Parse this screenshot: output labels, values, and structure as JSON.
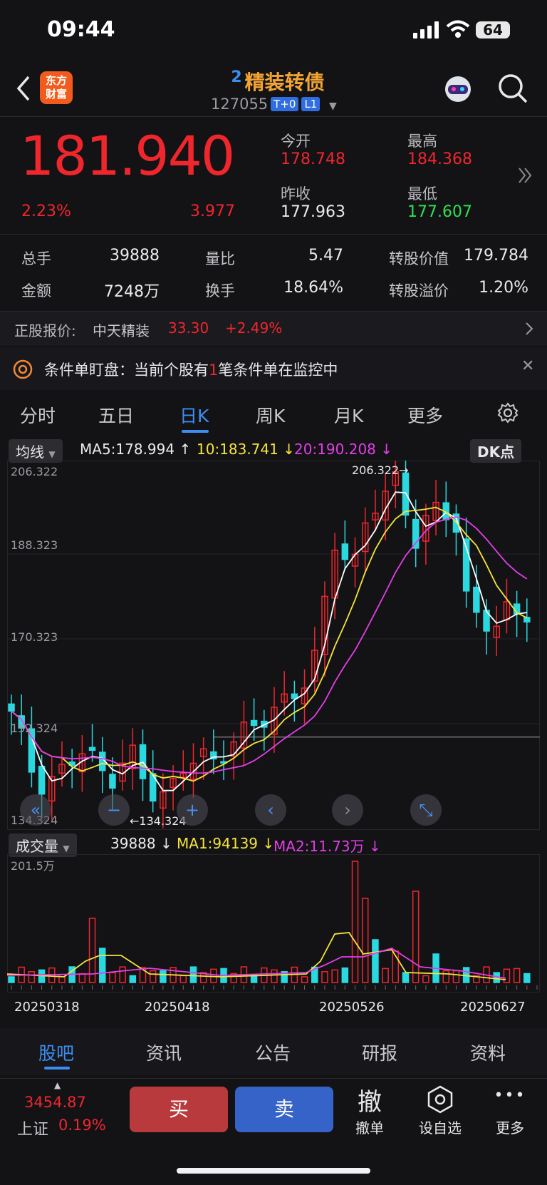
{
  "status_bar": {
    "time": "09:44",
    "battery": "64"
  },
  "header": {
    "logo_text": "东方\n财富",
    "badge": "2",
    "title": "精装转债",
    "code": "127055",
    "tags": [
      "T+0",
      "L1"
    ]
  },
  "quote": {
    "price": "181.940",
    "change_pct": "2.23%",
    "change": "3.977",
    "open_label": "今开",
    "open": "178.748",
    "high_label": "最高",
    "high": "184.368",
    "prev_close_label": "昨收",
    "prev_close": "177.963",
    "low_label": "最低",
    "low": "177.607"
  },
  "stats": [
    {
      "label": "总手",
      "value": "39888"
    },
    {
      "label": "量比",
      "value": "5.47"
    },
    {
      "label": "转股价值",
      "value": "179.784"
    },
    {
      "label": "金额",
      "value": "7248万"
    },
    {
      "label": "换手",
      "value": "18.64%"
    },
    {
      "label": "转股溢价",
      "value": "1.20%"
    }
  ],
  "stock_quote": {
    "label": "正股报价:",
    "name": "中天精装",
    "price": "33.30",
    "change": "+2.49%"
  },
  "notice": {
    "prefix": "条件单盯盘：当前个股有",
    "count": "1",
    "suffix": "笔条件单在监控中"
  },
  "kline_tabs": [
    "分时",
    "五日",
    "日K",
    "周K",
    "月K",
    "更多"
  ],
  "active_kline_tab": "日K",
  "ma_legend": {
    "selector": "均线",
    "ma5": "MA5:178.994",
    "ma10": "10:183.741",
    "ma20": "20:190.208",
    "dk": "DK点"
  },
  "price_axis": [
    "206.322",
    "188.323",
    "170.323",
    "152.324",
    "134.324"
  ],
  "annotations": {
    "high": "206.322",
    "low": "134.324"
  },
  "vol_legend": {
    "selector": "成交量",
    "vol": "39888",
    "ma1": "MA1:94139",
    "ma2": "MA2:11.73万"
  },
  "vol_axis": "201.5万",
  "dates": [
    "20250318",
    "20250418",
    "20250526",
    "20250627"
  ],
  "colors": {
    "up": "#f0262d",
    "down": "#2ad8e0",
    "ma5": "#ffffff",
    "ma10": "#f5e43a",
    "ma20": "#e23ee6",
    "accent": "#3d8df0"
  },
  "chart_data": {
    "type": "candlestick",
    "ylim": [
      134.324,
      206.322
    ],
    "vol_max": "201.5万",
    "max_annotation": "206.322",
    "min_annotation": "134.324",
    "series": [
      {
        "name": "MA5"
      },
      {
        "name": "MA10"
      },
      {
        "name": "MA20"
      }
    ]
  },
  "bottom_tabs": [
    "股吧",
    "资讯",
    "公告",
    "研报",
    "资料"
  ],
  "active_bottom_tab": "股吧",
  "index": {
    "value": "3454.87",
    "name": "上证",
    "change": "0.19%"
  },
  "trade": {
    "buy": "买",
    "sell": "卖"
  },
  "actions": [
    {
      "icon": "撤",
      "label": "撤单"
    },
    {
      "icon": "⬡",
      "label": "设自选"
    },
    {
      "icon": "•••",
      "label": "更多"
    }
  ]
}
